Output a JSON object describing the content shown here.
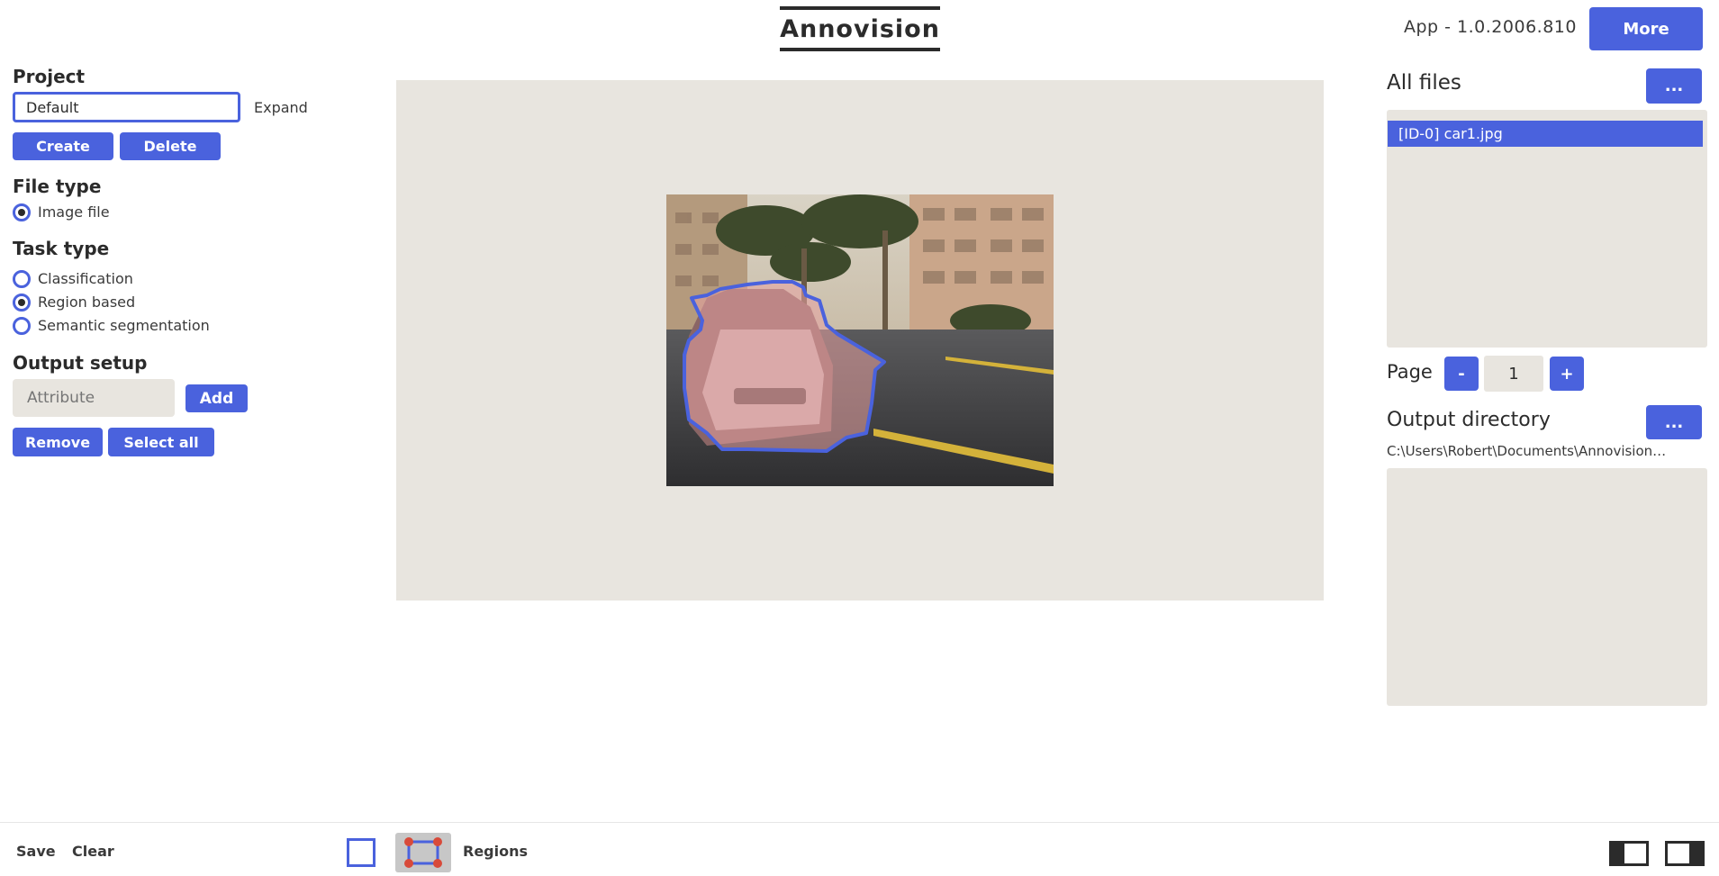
{
  "header": {
    "title": "Annovision",
    "version": "App - 1.0.2006.810",
    "more_label": "More"
  },
  "project": {
    "heading": "Project",
    "name_value": "Default",
    "expand_label": "Expand",
    "create_label": "Create",
    "delete_label": "Delete"
  },
  "file_type": {
    "heading": "File type",
    "options": [
      {
        "label": "Image file",
        "selected": true
      }
    ]
  },
  "task_type": {
    "heading": "Task type",
    "options": [
      {
        "label": "Classification",
        "selected": false
      },
      {
        "label": "Region based",
        "selected": true
      },
      {
        "label": "Semantic segmentation",
        "selected": false
      }
    ]
  },
  "output_setup": {
    "heading": "Output setup",
    "attribute_placeholder": "Attribute",
    "add_label": "Add",
    "remove_label": "Remove",
    "select_all_label": "Select all"
  },
  "files": {
    "heading": "All files",
    "menu_label": "...",
    "items": [
      {
        "label": "[ID-0] car1.jpg",
        "selected": true
      }
    ]
  },
  "pagination": {
    "label": "Page",
    "minus_label": "-",
    "value": "1",
    "plus_label": "+"
  },
  "output_directory": {
    "heading": "Output directory",
    "menu_label": "...",
    "path": "C:\\Users\\Robert\\Documents\\Annovision…"
  },
  "footer": {
    "save_label": "Save",
    "clear_label": "Clear",
    "regions_label": "Regions"
  },
  "colors": {
    "accent": "#4a62dd",
    "panel": "#e8e5df",
    "text": "#2b2b2b",
    "region_outline": "#4a62dd",
    "region_fill": "#e8a3a3"
  },
  "icons": {
    "rect_tool": "square-outline-icon",
    "polygon_tool": "polygon-handles-icon",
    "layout_left": "layout-left-panel-icon",
    "layout_right": "layout-right-panel-icon"
  }
}
